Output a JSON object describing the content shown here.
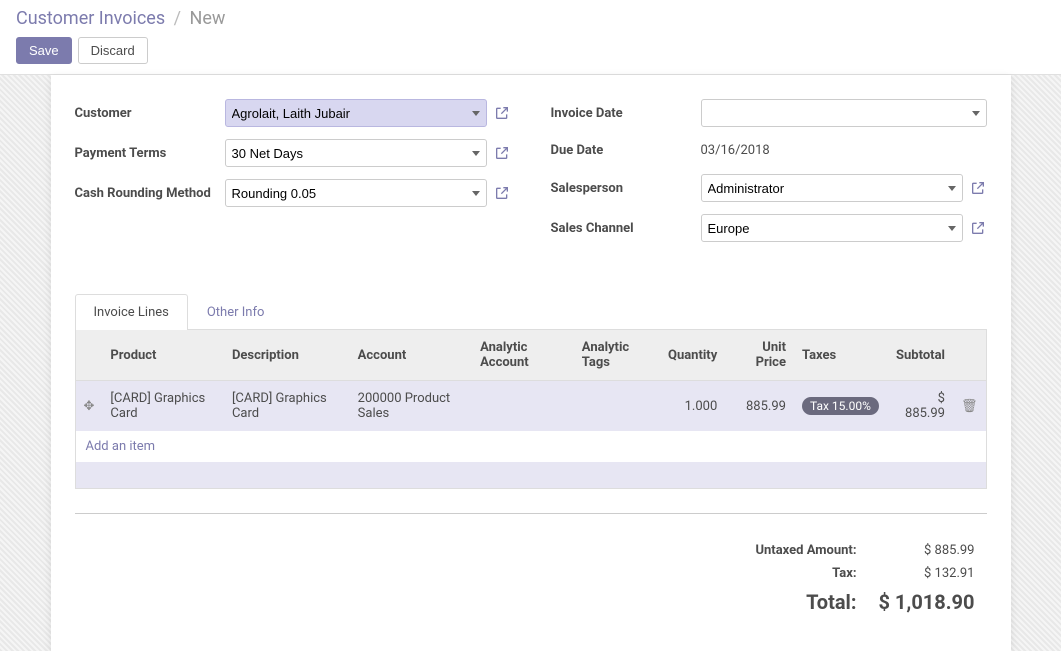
{
  "breadcrumb": {
    "root": "Customer Invoices",
    "current": "New"
  },
  "buttons": {
    "save": "Save",
    "discard": "Discard"
  },
  "labels": {
    "customer": "Customer",
    "payment_terms": "Payment Terms",
    "cash_rounding": "Cash Rounding Method",
    "invoice_date": "Invoice Date",
    "due_date": "Due Date",
    "salesperson": "Salesperson",
    "sales_channel": "Sales Channel"
  },
  "fields": {
    "customer": "Agrolait, Laith Jubair",
    "payment_terms": "30 Net Days",
    "cash_rounding": "Rounding 0.05",
    "invoice_date": "",
    "due_date": "03/16/2018",
    "salesperson": "Administrator",
    "sales_channel": "Europe"
  },
  "tabs": {
    "invoice_lines": "Invoice Lines",
    "other_info": "Other Info"
  },
  "columns": {
    "product": "Product",
    "description": "Description",
    "account": "Account",
    "analytic_account": "Analytic Account",
    "analytic_tags": "Analytic Tags",
    "quantity": "Quantity",
    "unit_price": "Unit Price",
    "taxes": "Taxes",
    "subtotal": "Subtotal"
  },
  "lines": [
    {
      "product": "[CARD] Graphics Card",
      "description": "[CARD] Graphics Card",
      "account": "200000 Product Sales",
      "analytic_account": "",
      "analytic_tags": "",
      "quantity": "1.000",
      "unit_price": "885.99",
      "taxes": "Tax 15.00%",
      "subtotal": "$ 885.99"
    }
  ],
  "add_item": "Add an item",
  "totals": {
    "untaxed_label": "Untaxed Amount:",
    "untaxed_value": "$ 885.99",
    "tax_label": "Tax:",
    "tax_value": "$ 132.91",
    "total_label": "Total:",
    "total_value": "$ 1,018.90"
  }
}
